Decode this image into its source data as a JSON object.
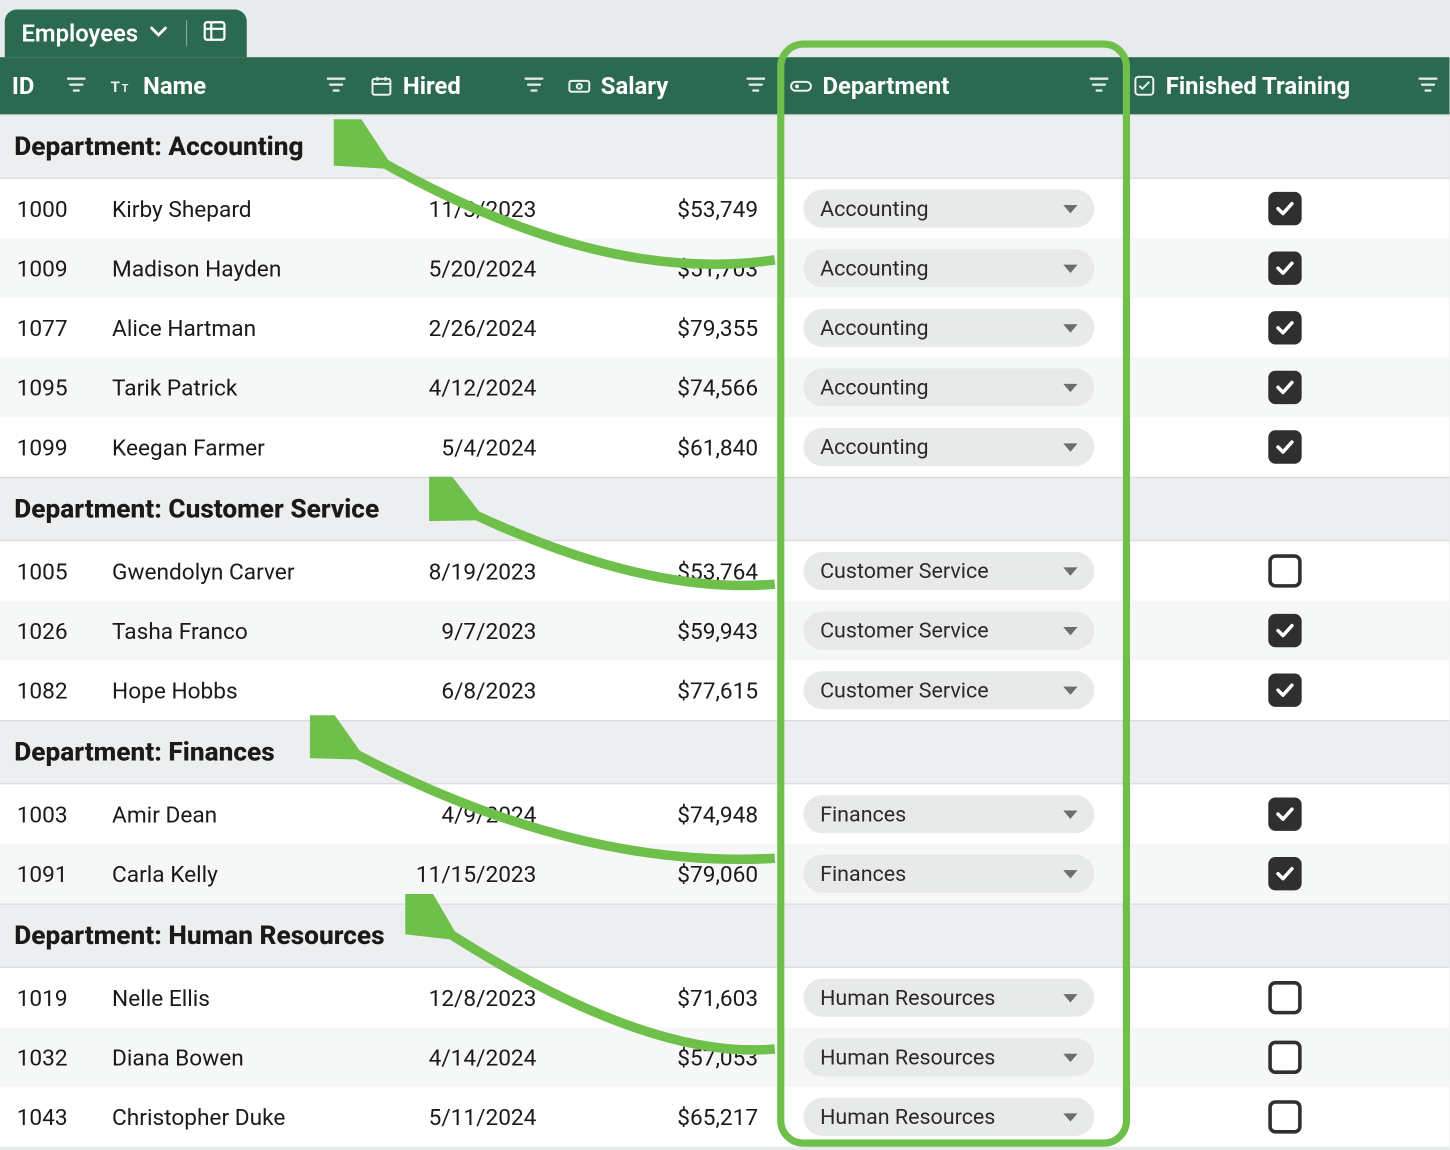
{
  "tab": {
    "label": "Employees"
  },
  "columns": {
    "id": "ID",
    "name": "Name",
    "hired": "Hired",
    "salary": "Salary",
    "department": "Department",
    "finished_training": "Finished Training"
  },
  "group_prefix": "Department: ",
  "groups": [
    {
      "name": "Accounting",
      "rows": [
        {
          "id": "1000",
          "name": "Kirby Shepard",
          "hired": "11/3/2023",
          "salary": "$53,749",
          "department": "Accounting",
          "trained": true
        },
        {
          "id": "1009",
          "name": "Madison Hayden",
          "hired": "5/20/2024",
          "salary": "$51,703",
          "department": "Accounting",
          "trained": true
        },
        {
          "id": "1077",
          "name": "Alice Hartman",
          "hired": "2/26/2024",
          "salary": "$79,355",
          "department": "Accounting",
          "trained": true
        },
        {
          "id": "1095",
          "name": "Tarik Patrick",
          "hired": "4/12/2024",
          "salary": "$74,566",
          "department": "Accounting",
          "trained": true
        },
        {
          "id": "1099",
          "name": "Keegan Farmer",
          "hired": "5/4/2024",
          "salary": "$61,840",
          "department": "Accounting",
          "trained": true
        }
      ]
    },
    {
      "name": "Customer Service",
      "rows": [
        {
          "id": "1005",
          "name": "Gwendolyn Carver",
          "hired": "8/19/2023",
          "salary": "$53,764",
          "department": "Customer Service",
          "trained": false
        },
        {
          "id": "1026",
          "name": "Tasha Franco",
          "hired": "9/7/2023",
          "salary": "$59,943",
          "department": "Customer Service",
          "trained": true
        },
        {
          "id": "1082",
          "name": "Hope Hobbs",
          "hired": "6/8/2023",
          "salary": "$77,615",
          "department": "Customer Service",
          "trained": true
        }
      ]
    },
    {
      "name": "Finances",
      "rows": [
        {
          "id": "1003",
          "name": "Amir Dean",
          "hired": "4/9/2024",
          "salary": "$74,948",
          "department": "Finances",
          "trained": true
        },
        {
          "id": "1091",
          "name": "Carla Kelly",
          "hired": "11/15/2023",
          "salary": "$79,060",
          "department": "Finances",
          "trained": true
        }
      ]
    },
    {
      "name": "Human Resources",
      "rows": [
        {
          "id": "1019",
          "name": "Nelle Ellis",
          "hired": "12/8/2023",
          "salary": "$71,603",
          "department": "Human Resources",
          "trained": false
        },
        {
          "id": "1032",
          "name": "Diana Bowen",
          "hired": "4/14/2024",
          "salary": "$57,053",
          "department": "Human Resources",
          "trained": false
        },
        {
          "id": "1043",
          "name": "Christopher Duke",
          "hired": "5/11/2024",
          "salary": "$65,217",
          "department": "Human Resources",
          "trained": false
        }
      ]
    }
  ]
}
